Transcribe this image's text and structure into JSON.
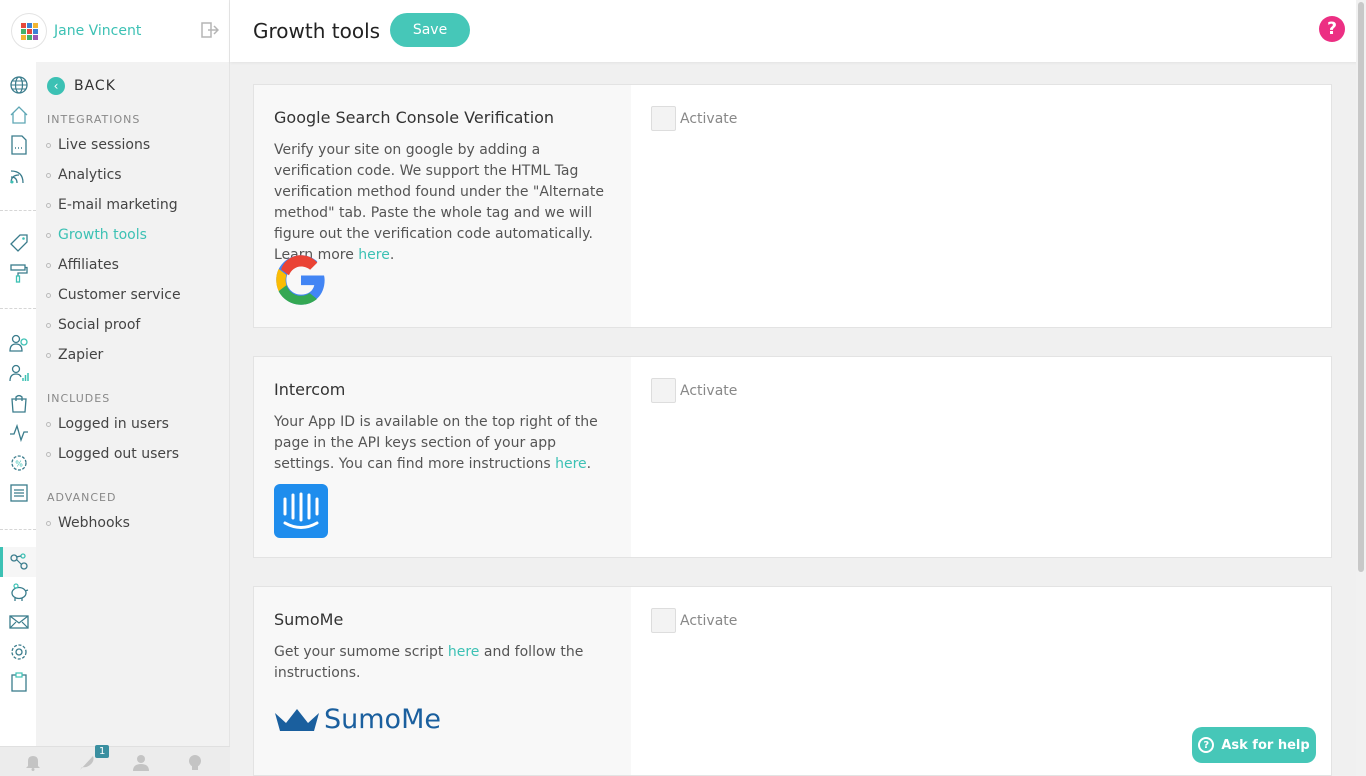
{
  "user": {
    "name": "Jane Vincent"
  },
  "header": {
    "title": "Growth tools",
    "save_label": "Save",
    "help_label": "?"
  },
  "subnav": {
    "back_label": "BACK",
    "sections": [
      {
        "title": "INTEGRATIONS",
        "items": [
          "Live sessions",
          "Analytics",
          "E-mail marketing",
          "Growth tools",
          "Affiliates",
          "Customer service",
          "Social proof",
          "Zapier"
        ]
      },
      {
        "title": "INCLUDES",
        "items": [
          "Logged in users",
          "Logged out users"
        ]
      },
      {
        "title": "ADVANCED",
        "items": [
          "Webhooks"
        ]
      }
    ],
    "active_item": "Growth tools"
  },
  "bottombar": {
    "badge_count": "1"
  },
  "cards": [
    {
      "title": "Google Search Console Verification",
      "text": "Verify your site on google by adding a verification code. We support the HTML Tag verification method found under the \"Alternate method\" tab. Paste the whole tag and we will figure out the verification code automatically. Learn more",
      "link": "here",
      "after_link": ".",
      "activate_label": "Activate",
      "logo": "google-logo"
    },
    {
      "title": "Intercom",
      "text": "Your App ID is available on the top right of the page in the API keys section of your app settings. You can find more instructions",
      "link": "here",
      "after_link": ".",
      "activate_label": "Activate",
      "logo": "intercom-logo"
    },
    {
      "title": "SumoMe",
      "text": "Get your sumome script",
      "link": "here",
      "after_link": "and follow the instructions.",
      "activate_label": "Activate",
      "logo": "sumome-logo",
      "logo_text": "SumoMe"
    }
  ],
  "ask_help": {
    "label": "Ask for help"
  },
  "colors": {
    "accent": "#3cc1b4",
    "help_pink": "#ec2f83",
    "intercom_blue": "#1f8ded",
    "sumome_blue": "#1a5f9e"
  }
}
